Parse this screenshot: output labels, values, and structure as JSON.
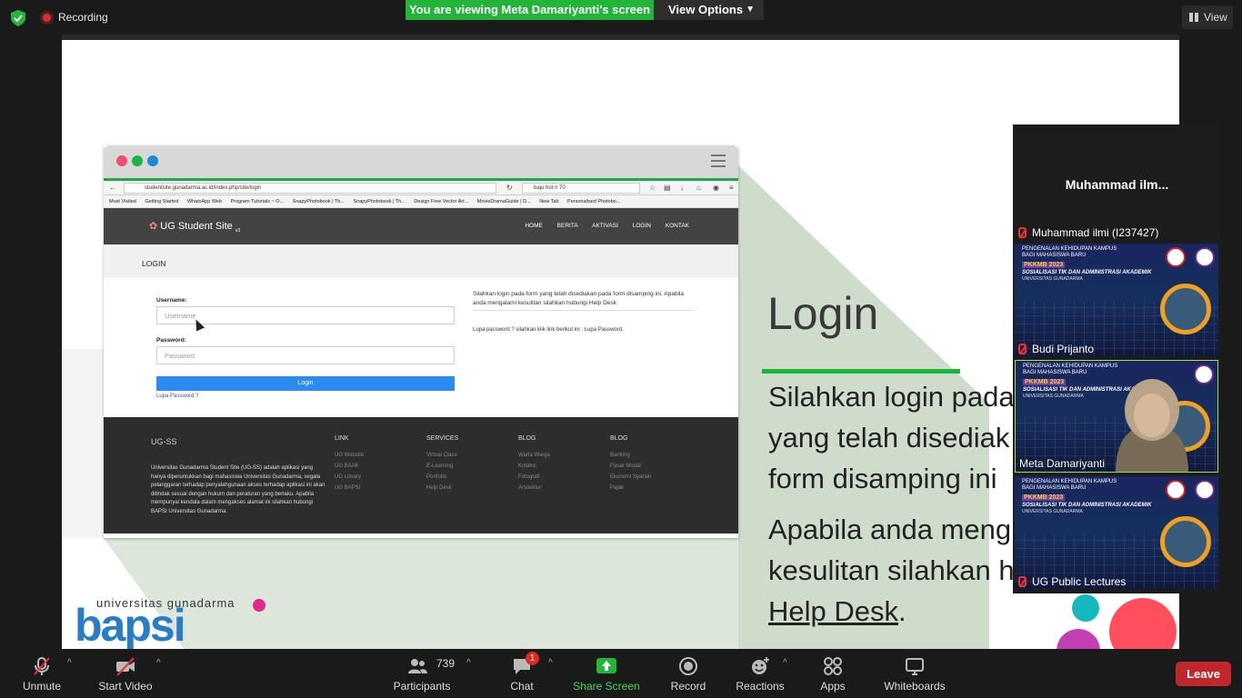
{
  "topbar": {
    "recording_label": "Recording",
    "viewing_label": "You are viewing Meta Damariyanti's screen",
    "view_options_label": "View Options",
    "view_label": "View"
  },
  "browser": {
    "url": "studentsite.gunadarma.ac.id/index.php/site/login",
    "search_text": "baju hut ri 70",
    "bookmarks": [
      "Most Visited",
      "Getting Started",
      "WhatsApp Web",
      "Program Tutorials ~ O...",
      "SnapyPhotobook | Th...",
      "SnapyPhotobook | Th...",
      "Design Free Vector Art...",
      "MovieDramaGuide | D...",
      "New Tab",
      "Personalised Photobo..."
    ],
    "site_brand": "UG Student Site",
    "site_brand_version": "v3",
    "nav": [
      "HOME",
      "BERITA",
      "AKTIVASI",
      "LOGIN",
      "KONTAK"
    ],
    "page_title": "LOGIN",
    "username_label": "Username:",
    "username_placeholder": "Username",
    "password_label": "Password:",
    "password_placeholder": "Password",
    "login_button": "Login",
    "forgot_link": "Lupa Password ?",
    "info_text": "Silahkan login pada form yang telah disediakan pada form disamping ini. Apabila anda mengalami kesulitan silahkan hubungi Help Desk",
    "info_forgot": "Lupa password ? silahkan klik link berikut ini : Lupa Password.",
    "footer_brand": "UG-SS",
    "footer_desc": "Universitas Gunadarma Student Site (UG-SS) adalah aplikasi yang hanya diperuntukkan bagi mahasiswa Universitas Gunadarma, segala pelanggaran terhadap penyalahgunaan akses terhadap aplikasi ini akan ditindak sesuai dengan hukum dan peraturan yang berlaku. Apabila mempunyai kendala dalam mengakses alamat ini silahkan hubungi BAPSI Universitas Gunadarma.",
    "footer_cols": [
      {
        "heading": "LINK",
        "items": [
          "UG Website",
          "UG BAAK",
          "UG Library",
          "UG BAPSI"
        ]
      },
      {
        "heading": "SERVICES",
        "items": [
          "Virtual Class",
          "E-Learning",
          "Portfolio",
          "Help Desk"
        ]
      },
      {
        "heading": "BLOG",
        "items": [
          "Warta Warga",
          "Kotaksi",
          "Fotografi",
          "Arsitektur"
        ]
      },
      {
        "heading": "BLOG",
        "items": [
          "Banking",
          "Pasar Modal",
          "Ekonomi Syariah",
          "Pajak"
        ]
      }
    ]
  },
  "slide": {
    "title": "Login",
    "para1_lines": [
      "Silahkan login pada",
      "yang telah disediak",
      "form disamping ini"
    ],
    "para2_lines": [
      "Apabila anda meng",
      "kesulitan silahkan h"
    ],
    "help_desk": "Help Desk",
    "help_desk_suffix": ".",
    "logo_top": "universitas gunadarma",
    "logo_word": "bapsi"
  },
  "participants_panel": {
    "title": "Muhammad  ilm...",
    "people": [
      {
        "name": "Muhammad ilmi (I237427)"
      },
      {
        "name": "Budi Prijanto"
      },
      {
        "name": "Meta Damariyanti"
      },
      {
        "name": "UG Public Lectures"
      }
    ],
    "tile_text": {
      "line1": "PENGENALAN KEHIDUPAN KAMPUS",
      "line2": "BAGI MAHASISWA BARU",
      "line3": "PKKMB 2023",
      "line4": "SOSIALISASI TIK DAN ADMINISTRASI AKADEMIK",
      "line5": "UNIVERSITAS GUNADARMA"
    }
  },
  "toolbar": {
    "unmute": "Unmute",
    "start_video": "Start Video",
    "participants": "Participants",
    "participants_count": "739",
    "chat": "Chat",
    "chat_badge": "1",
    "share_screen": "Share Screen",
    "record": "Record",
    "reactions": "Reactions",
    "apps": "Apps",
    "whiteboards": "Whiteboards",
    "leave": "Leave"
  }
}
